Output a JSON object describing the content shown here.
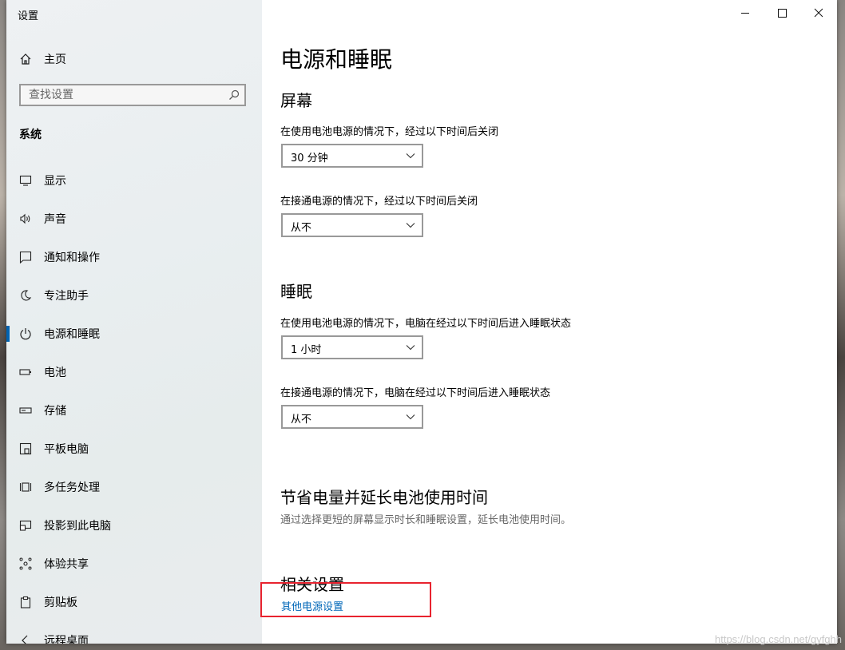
{
  "window": {
    "title": "设置"
  },
  "sidebar": {
    "home_label": "主页",
    "search_placeholder": "查找设置",
    "section_label": "系统",
    "items": [
      {
        "label": "显示",
        "icon": "monitor-icon"
      },
      {
        "label": "声音",
        "icon": "speaker-icon"
      },
      {
        "label": "通知和操作",
        "icon": "notification-icon"
      },
      {
        "label": "专注助手",
        "icon": "moon-icon"
      },
      {
        "label": "电源和睡眠",
        "icon": "power-icon",
        "active": true
      },
      {
        "label": "电池",
        "icon": "battery-icon"
      },
      {
        "label": "存储",
        "icon": "storage-icon"
      },
      {
        "label": "平板电脑",
        "icon": "tablet-icon"
      },
      {
        "label": "多任务处理",
        "icon": "multitask-icon"
      },
      {
        "label": "投影到此电脑",
        "icon": "project-icon"
      },
      {
        "label": "体验共享",
        "icon": "share-icon"
      },
      {
        "label": "剪贴板",
        "icon": "clipboard-icon"
      },
      {
        "label": "远程桌面",
        "icon": "remote-desktop-icon"
      }
    ]
  },
  "main": {
    "title": "电源和睡眠",
    "screen": {
      "heading": "屏幕",
      "battery_label": "在使用电池电源的情况下，经过以下时间后关闭",
      "battery_value": "30 分钟",
      "plugged_label": "在接通电源的情况下，经过以下时间后关闭",
      "plugged_value": "从不"
    },
    "sleep": {
      "heading": "睡眠",
      "battery_label": "在使用电池电源的情况下，电脑在经过以下时间后进入睡眠状态",
      "battery_value": "1 小时",
      "plugged_label": "在接通电源的情况下，电脑在经过以下时间后进入睡眠状态",
      "plugged_value": "从不"
    },
    "save": {
      "heading": "节省电量并延长电池使用时间",
      "hint": "通过选择更短的屏幕显示时长和睡眠设置，延长电池使用时间。"
    },
    "related": {
      "heading": "相关设置",
      "link": "其他电源设置"
    }
  },
  "watermark": "https://blog.csdn.net/gyfghh",
  "colors": {
    "accent": "#0063b1",
    "link": "#0067b8",
    "highlight": "#e8232f"
  }
}
